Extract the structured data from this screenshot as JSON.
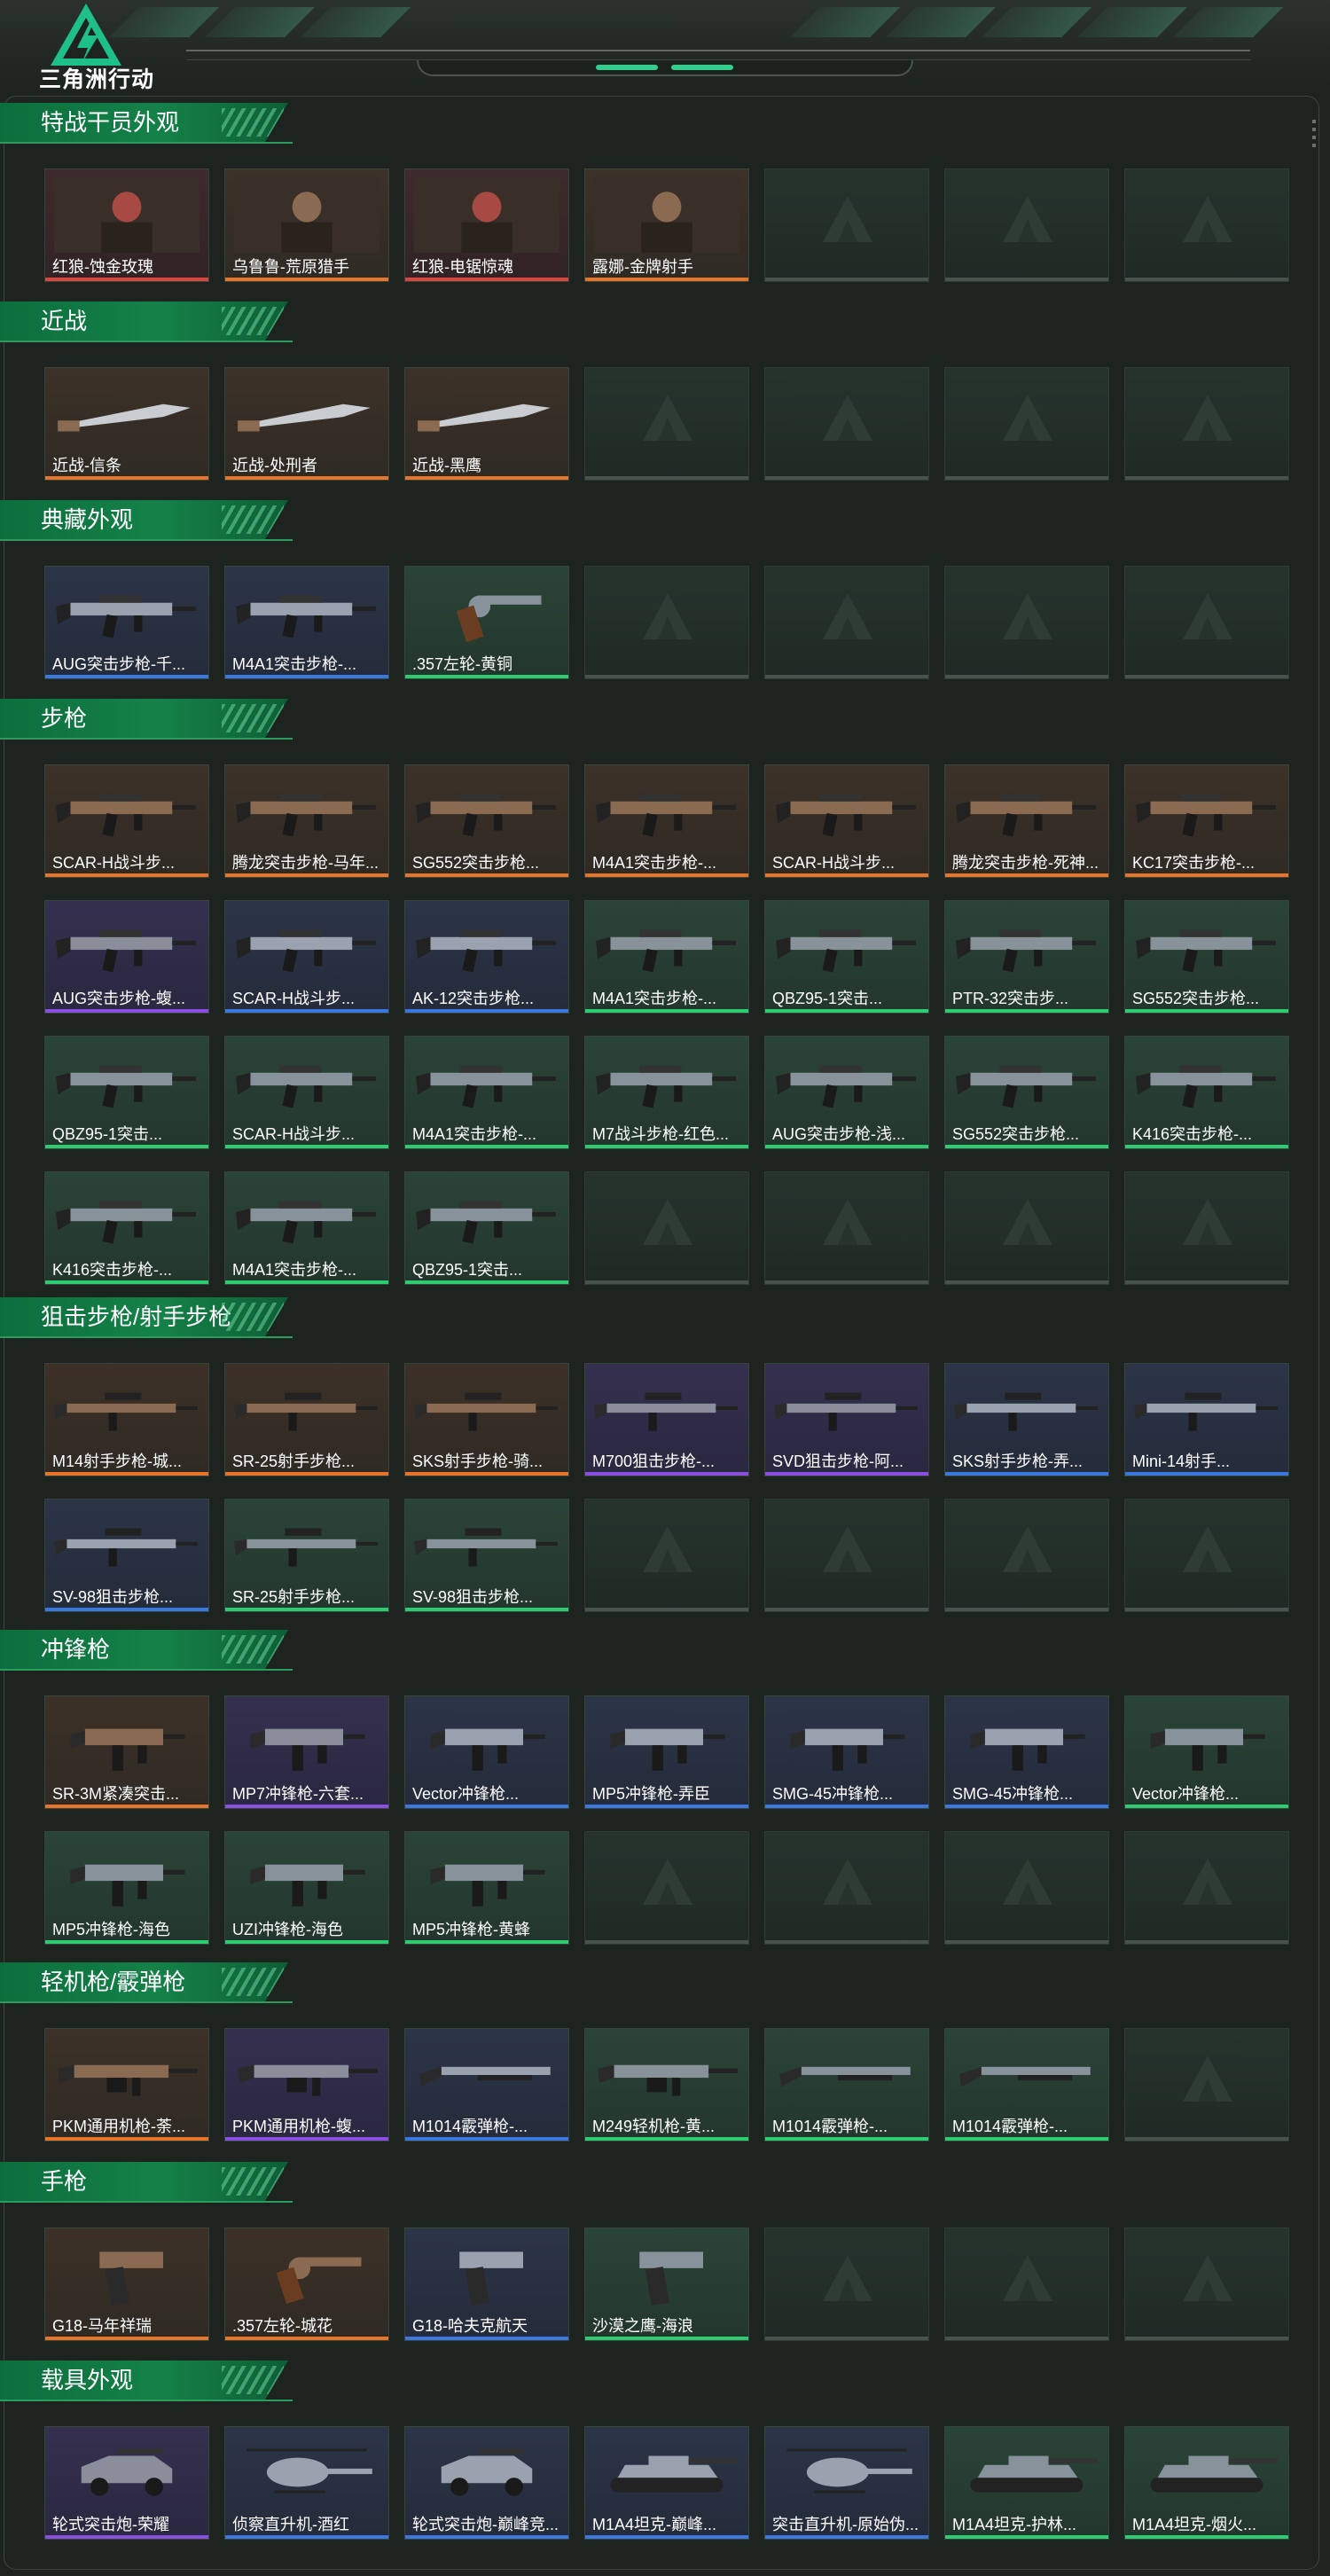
{
  "app": {
    "logo_text": "三角洲行动"
  },
  "colors": {
    "background": "#1d241f",
    "section_header": "#148248",
    "rarity_orange": "#e8742a",
    "rarity_purple": "#8a4fe0",
    "rarity_blue": "#3a78e0",
    "rarity_green": "#2ecc71",
    "rarity_red": "#d9453a",
    "empty": "#4a524e"
  },
  "sections": [
    {
      "title": "特战干员外观",
      "slots": 7,
      "items": [
        {
          "name": "红狼-蚀金玫瑰",
          "rarity": "red",
          "icon": "operator-portrait"
        },
        {
          "name": "乌鲁鲁-荒原猎手",
          "rarity": "orange",
          "icon": "operator-portrait"
        },
        {
          "name": "红狼-电锯惊魂",
          "rarity": "red",
          "icon": "operator-portrait"
        },
        {
          "name": "露娜-金牌射手",
          "rarity": "orange",
          "icon": "operator-portrait"
        }
      ]
    },
    {
      "title": "近战",
      "slots": 7,
      "items": [
        {
          "name": "近战-信条",
          "rarity": "orange",
          "icon": "knife"
        },
        {
          "name": "近战-处刑者",
          "rarity": "orange",
          "icon": "knife"
        },
        {
          "name": "近战-黑鹰",
          "rarity": "orange",
          "icon": "knife"
        }
      ]
    },
    {
      "title": "典藏外观",
      "slots": 7,
      "items": [
        {
          "name": "AUG突击步枪-千...",
          "rarity": "blue",
          "icon": "rifle"
        },
        {
          "name": "M4A1突击步枪-...",
          "rarity": "blue",
          "icon": "rifle"
        },
        {
          "name": ".357左轮-黄铜",
          "rarity": "green",
          "icon": "revolver"
        }
      ]
    },
    {
      "title": "步枪",
      "slots": 28,
      "items": [
        {
          "name": "SCAR-H战斗步...",
          "rarity": "orange",
          "icon": "rifle"
        },
        {
          "name": "腾龙突击步枪-马年...",
          "rarity": "orange",
          "icon": "rifle"
        },
        {
          "name": "SG552突击步枪...",
          "rarity": "orange",
          "icon": "rifle"
        },
        {
          "name": "M4A1突击步枪-...",
          "rarity": "orange",
          "icon": "rifle"
        },
        {
          "name": "SCAR-H战斗步...",
          "rarity": "orange",
          "icon": "rifle"
        },
        {
          "name": "腾龙突击步枪-死神...",
          "rarity": "orange",
          "icon": "rifle"
        },
        {
          "name": "KC17突击步枪-...",
          "rarity": "orange",
          "icon": "rifle"
        },
        {
          "name": "AUG突击步枪-蝮...",
          "rarity": "purple",
          "icon": "rifle"
        },
        {
          "name": "SCAR-H战斗步...",
          "rarity": "blue",
          "icon": "rifle"
        },
        {
          "name": "AK-12突击步枪...",
          "rarity": "blue",
          "icon": "rifle"
        },
        {
          "name": "M4A1突击步枪-...",
          "rarity": "green",
          "icon": "rifle"
        },
        {
          "name": "QBZ95-1突击...",
          "rarity": "green",
          "icon": "rifle"
        },
        {
          "name": "PTR-32突击步...",
          "rarity": "green",
          "icon": "rifle"
        },
        {
          "name": "SG552突击步枪...",
          "rarity": "green",
          "icon": "rifle"
        },
        {
          "name": "QBZ95-1突击...",
          "rarity": "green",
          "icon": "rifle"
        },
        {
          "name": "SCAR-H战斗步...",
          "rarity": "green",
          "icon": "rifle"
        },
        {
          "name": "M4A1突击步枪-...",
          "rarity": "green",
          "icon": "rifle"
        },
        {
          "name": "M7战斗步枪-红色...",
          "rarity": "green",
          "icon": "rifle"
        },
        {
          "name": "AUG突击步枪-浅...",
          "rarity": "green",
          "icon": "rifle"
        },
        {
          "name": "SG552突击步枪...",
          "rarity": "green",
          "icon": "rifle"
        },
        {
          "name": "K416突击步枪-...",
          "rarity": "green",
          "icon": "rifle"
        },
        {
          "name": "K416突击步枪-...",
          "rarity": "green",
          "icon": "rifle"
        },
        {
          "name": "M4A1突击步枪-...",
          "rarity": "green",
          "icon": "rifle"
        },
        {
          "name": "QBZ95-1突击...",
          "rarity": "green",
          "icon": "rifle"
        }
      ]
    },
    {
      "title": "狙击步枪/射手步枪",
      "slots": 14,
      "items": [
        {
          "name": "M14射手步枪-城...",
          "rarity": "orange",
          "icon": "sniper"
        },
        {
          "name": "SR-25射手步枪...",
          "rarity": "orange",
          "icon": "sniper"
        },
        {
          "name": "SKS射手步枪-骑...",
          "rarity": "orange",
          "icon": "sniper"
        },
        {
          "name": "M700狙击步枪-...",
          "rarity": "purple",
          "icon": "sniper"
        },
        {
          "name": "SVD狙击步枪-阿...",
          "rarity": "purple",
          "icon": "sniper"
        },
        {
          "name": "SKS射手步枪-弄...",
          "rarity": "blue",
          "icon": "sniper"
        },
        {
          "name": "Mini-14射手...",
          "rarity": "blue",
          "icon": "sniper"
        },
        {
          "name": "SV-98狙击步枪...",
          "rarity": "blue",
          "icon": "sniper"
        },
        {
          "name": "SR-25射手步枪...",
          "rarity": "green",
          "icon": "sniper"
        },
        {
          "name": "SV-98狙击步枪...",
          "rarity": "green",
          "icon": "sniper"
        }
      ]
    },
    {
      "title": "冲锋枪",
      "slots": 14,
      "items": [
        {
          "name": "SR-3M紧凑突击...",
          "rarity": "orange",
          "icon": "smg"
        },
        {
          "name": "MP7冲锋枪-六套...",
          "rarity": "purple",
          "icon": "smg"
        },
        {
          "name": "Vector冲锋枪...",
          "rarity": "blue",
          "icon": "smg"
        },
        {
          "name": "MP5冲锋枪-弄臣",
          "rarity": "blue",
          "icon": "smg"
        },
        {
          "name": "SMG-45冲锋枪...",
          "rarity": "blue",
          "icon": "smg"
        },
        {
          "name": "SMG-45冲锋枪...",
          "rarity": "blue",
          "icon": "smg"
        },
        {
          "name": "Vector冲锋枪...",
          "rarity": "green",
          "icon": "smg"
        },
        {
          "name": "MP5冲锋枪-海色",
          "rarity": "green",
          "icon": "smg"
        },
        {
          "name": "UZI冲锋枪-海色",
          "rarity": "green",
          "icon": "smg"
        },
        {
          "name": "MP5冲锋枪-黄蜂",
          "rarity": "green",
          "icon": "smg"
        }
      ]
    },
    {
      "title": "轻机枪/霰弹枪",
      "slots": 7,
      "items": [
        {
          "name": "PKM通用机枪-荼...",
          "rarity": "orange",
          "icon": "lmg"
        },
        {
          "name": "PKM通用机枪-蝮...",
          "rarity": "purple",
          "icon": "lmg"
        },
        {
          "name": "M1014霰弹枪-...",
          "rarity": "blue",
          "icon": "shotgun"
        },
        {
          "name": "M249轻机枪-黄...",
          "rarity": "green",
          "icon": "lmg"
        },
        {
          "name": "M1014霰弹枪-...",
          "rarity": "green",
          "icon": "shotgun"
        },
        {
          "name": "M1014霰弹枪-...",
          "rarity": "green",
          "icon": "shotgun"
        }
      ]
    },
    {
      "title": "手枪",
      "slots": 7,
      "items": [
        {
          "name": "G18-马年祥瑞",
          "rarity": "orange",
          "icon": "pistol"
        },
        {
          "name": ".357左轮-城花",
          "rarity": "orange",
          "icon": "revolver"
        },
        {
          "name": "G18-哈夫克航天",
          "rarity": "blue",
          "icon": "pistol"
        },
        {
          "name": "沙漠之鹰-海浪",
          "rarity": "green",
          "icon": "pistol"
        }
      ]
    },
    {
      "title": "载具外观",
      "slots": 7,
      "items": [
        {
          "name": "轮式突击炮-荣耀",
          "rarity": "purple",
          "icon": "vehicle"
        },
        {
          "name": "侦察直升机-酒红",
          "rarity": "blue",
          "icon": "helicopter"
        },
        {
          "name": "轮式突击炮-巅峰竞...",
          "rarity": "blue",
          "icon": "vehicle"
        },
        {
          "name": "M1A4坦克-巅峰...",
          "rarity": "blue",
          "icon": "tank"
        },
        {
          "name": "突击直升机-原始伪...",
          "rarity": "blue",
          "icon": "helicopter"
        },
        {
          "name": "M1A4坦克-护林...",
          "rarity": "green",
          "icon": "tank"
        },
        {
          "name": "M1A4坦克-烟火...",
          "rarity": "green",
          "icon": "tank"
        }
      ]
    }
  ]
}
